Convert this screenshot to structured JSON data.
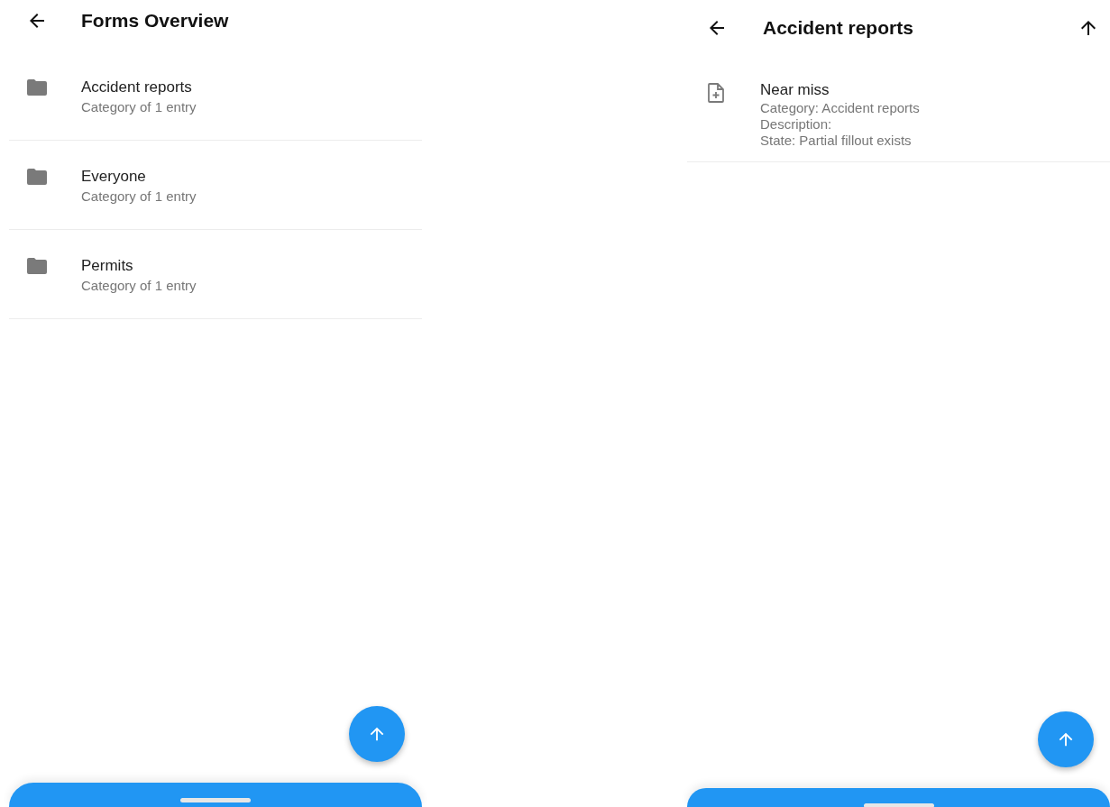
{
  "screens": [
    {
      "title": "Forms Overview",
      "items": [
        {
          "kind": "folder",
          "title": "Accident reports",
          "lines": [
            "Category of 1 entry"
          ]
        },
        {
          "kind": "folder",
          "title": "Everyone",
          "lines": [
            "Category of 1 entry"
          ]
        },
        {
          "kind": "folder",
          "title": "Permits",
          "lines": [
            "Category of 1 entry"
          ]
        }
      ]
    },
    {
      "title": "Accident reports",
      "actions": [
        {
          "kind": "up"
        }
      ],
      "items": [
        {
          "kind": "form",
          "title": "Near miss",
          "lines": [
            "Category: Accident reports",
            "Description:",
            "State: Partial fillout exists"
          ]
        }
      ]
    }
  ]
}
